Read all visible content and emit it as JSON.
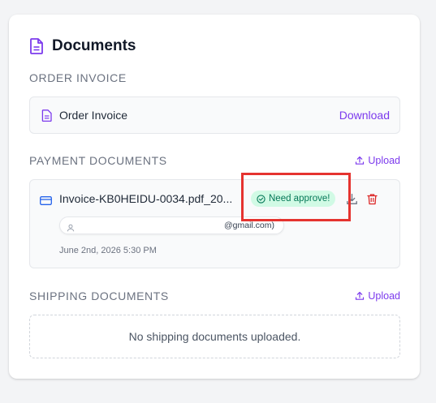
{
  "card": {
    "title": "Documents"
  },
  "order_invoice": {
    "section_label": "ORDER INVOICE",
    "file_name": "Order Invoice",
    "download_label": "Download"
  },
  "payment_documents": {
    "section_label": "PAYMENT DOCUMENTS",
    "upload_label": "Upload",
    "items": [
      {
        "file_name": "Invoice-KB0HEIDU-0034.pdf_20...",
        "status": "Need approve!",
        "uploader_email_suffix": "@gmail.com)",
        "date": "June 2nd, 2026 5:30 PM"
      }
    ]
  },
  "shipping_documents": {
    "section_label": "SHIPPING DOCUMENTS",
    "upload_label": "Upload",
    "empty_message": "No shipping documents uploaded."
  },
  "colors": {
    "accent": "#7c3aed",
    "status_bg": "#d1fae5",
    "status_text": "#047857",
    "delete": "#dc2626",
    "highlight": "#e5332f"
  }
}
